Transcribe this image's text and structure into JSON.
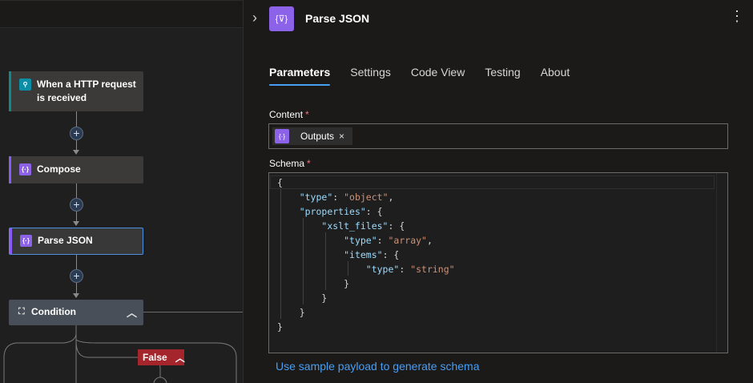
{
  "canvas": {
    "nodes": [
      {
        "label": "When a HTTP request is received",
        "icon": "http-request-icon"
      },
      {
        "label": "Compose",
        "icon": "compose-icon"
      },
      {
        "label": "Parse JSON",
        "icon": "parse-json-icon"
      },
      {
        "label": "Condition",
        "icon": "condition-icon"
      }
    ],
    "false_label": "False"
  },
  "panel": {
    "title": "Parse JSON",
    "tabs": [
      {
        "label": "Parameters",
        "active": true
      },
      {
        "label": "Settings",
        "active": false
      },
      {
        "label": "Code View",
        "active": false
      },
      {
        "label": "Testing",
        "active": false
      },
      {
        "label": "About",
        "active": false
      }
    ],
    "content": {
      "label": "Content",
      "required_mark": "*",
      "token": "Outputs",
      "token_close": "×"
    },
    "schema": {
      "label": "Schema",
      "required_mark": "*",
      "lines": [
        "{",
        "    \"type\": \"object\",",
        "    \"properties\": {",
        "        \"xslt_files\": {",
        "            \"type\": \"array\",",
        "            \"items\": {",
        "                \"type\": \"string\"",
        "            }",
        "        }",
        "    }",
        "}"
      ]
    },
    "sample_link": "Use sample payload to generate schema"
  },
  "colors": {
    "accent": "#479ef5",
    "action_purple": "#8b62e8",
    "trigger_teal": "#0f8a8a",
    "false_red": "#a4262c"
  }
}
